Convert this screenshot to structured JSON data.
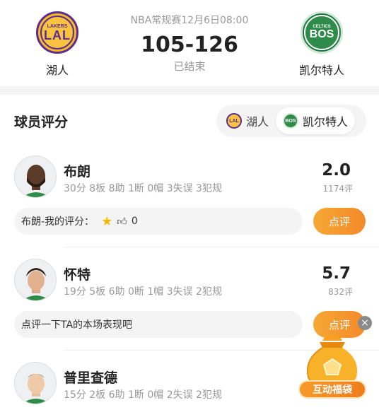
{
  "match": {
    "meta": "NBA常规赛12月6日08:00",
    "score": "105-126",
    "status": "已结束"
  },
  "home_team": {
    "name": "湖人",
    "logo_small": "LAKERS",
    "logo_big": "LAL"
  },
  "away_team": {
    "name": "凯尔特人",
    "logo_small": "CELTICS",
    "logo_big": "BOS"
  },
  "section": {
    "title": "球员评分"
  },
  "team_switch": [
    {
      "label": "湖人",
      "mini": "LAL",
      "active": false
    },
    {
      "label": "凯尔特人",
      "mini": "BOS",
      "active": true
    }
  ],
  "players": [
    {
      "name": "布朗",
      "stats": "30分 8板 8助 1断 0帽 3失误 3犯规",
      "score": "2.0",
      "count": "1174评",
      "comment_label": "布朗-我的评分：",
      "likes": "0",
      "rate_label": "点评"
    },
    {
      "name": "怀特",
      "stats": "19分 5板 6助 0断 1帽 3失误 2犯规",
      "score": "5.7",
      "count": "832评",
      "comment_placeholder": "点评一下TA的本场表现吧",
      "rate_label": "点评"
    },
    {
      "name": "普里查德",
      "stats": "15分 2板 6助 1断 0帽 2失误 2犯规"
    }
  ],
  "floating": {
    "label": "互动福袋",
    "close": "×"
  },
  "colors": {
    "accent": "#f48a2a",
    "lakers_purple": "#5b2d8e",
    "lakers_gold": "#f9c342",
    "celtics_green": "#2e8b4a",
    "star": "#f5b800"
  },
  "icons": [
    "star-icon",
    "thumb-up-icon",
    "close-icon",
    "lucky-bag-icon"
  ]
}
